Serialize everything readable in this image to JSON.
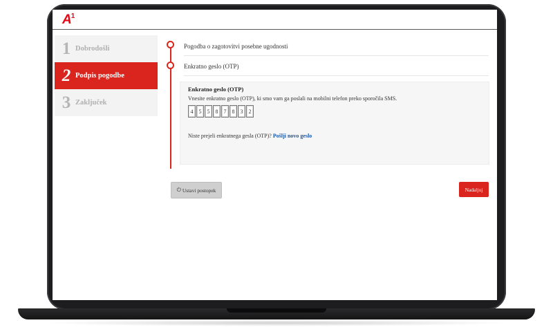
{
  "header": {
    "logo_letter": "A",
    "logo_superscript": "1"
  },
  "steps": [
    {
      "number": "1",
      "label": "Dobrodošli",
      "active": false
    },
    {
      "number": "2",
      "label": "Podpis pogodbe",
      "active": true
    },
    {
      "number": "3",
      "label": "Zaključek",
      "active": false
    }
  ],
  "sections": {
    "agreement_title": "Pogodba o zagotovitvi posebne ugodnosti",
    "otp_title": "Enkratno geslo (OTP)"
  },
  "otp_panel": {
    "title": "Enkratno geslo (OTP)",
    "description": "Vnesite enkratno geslo (OTP), ki smo vam ga poslali na mobilni telefon preko sporočila SMS.",
    "digits": [
      "4",
      "5",
      "5",
      "8",
      "7",
      "8",
      "3",
      "2"
    ],
    "resend_prefix": "Niste prejeli enkratnega gesla (OTP)?",
    "resend_link": "Pošlji novo geslo"
  },
  "buttons": {
    "stop_label": "Ustavi postopek",
    "next_label": "Nadaljuj"
  },
  "colors": {
    "brand_red": "#d9251d",
    "link_blue": "#1b57a8"
  },
  "icons": {
    "stop": "power-icon"
  }
}
